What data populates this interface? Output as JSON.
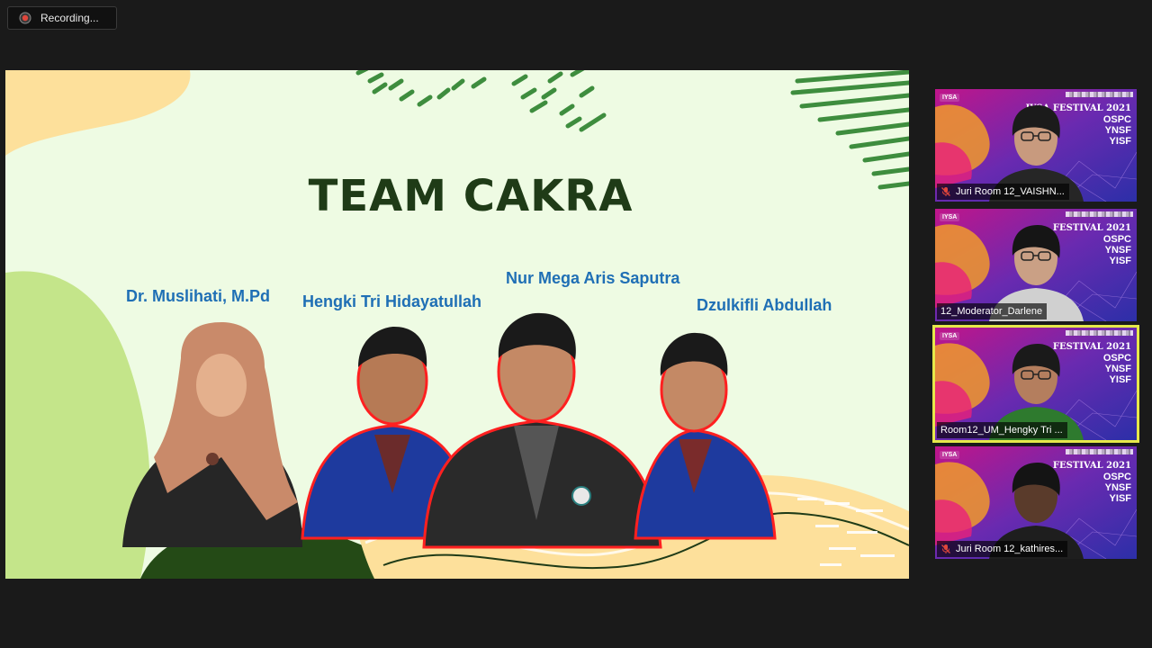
{
  "recording": {
    "label": "Recording..."
  },
  "slide": {
    "title": "TEAM CAKRA",
    "members": [
      "Dr. Muslihati, M.Pd",
      "Hengki Tri Hidayatullah",
      "Nur Mega Aris Saputra",
      "Dzulkifli Abdullah"
    ],
    "colors": {
      "background": "#eefbe3",
      "title": "#1f3b17",
      "names": "#1f6fb5",
      "accent_green": "#3e8d3e",
      "accent_yellow": "#fde09b"
    }
  },
  "participants": [
    {
      "name": "Juri Room 12_VAISHN...",
      "muted": true,
      "active": false,
      "banner": [
        "IYSA FESTIVAL 2021",
        "OSPC",
        "YNSF",
        "YISF"
      ],
      "logo": "IYSA"
    },
    {
      "name": "12_Moderator_Darlene",
      "muted": false,
      "active": false,
      "banner": [
        "FESTIVAL 2021",
        "OSPC",
        "YNSF",
        "YISF"
      ],
      "logo": "IYSA"
    },
    {
      "name": "Room12_UM_Hengky Tri ...",
      "muted": false,
      "active": true,
      "banner": [
        "FESTIVAL 2021",
        "OSPC",
        "YNSF",
        "YISF"
      ],
      "logo": "IYSA"
    },
    {
      "name": "Juri Room 12_kathires...",
      "muted": true,
      "active": false,
      "banner": [
        "FESTIVAL 2021",
        "OSPC",
        "YNSF",
        "YISF"
      ],
      "logo": "IYSA"
    }
  ],
  "icons": {
    "recording": "record-icon",
    "muted": "mic-off-icon"
  }
}
